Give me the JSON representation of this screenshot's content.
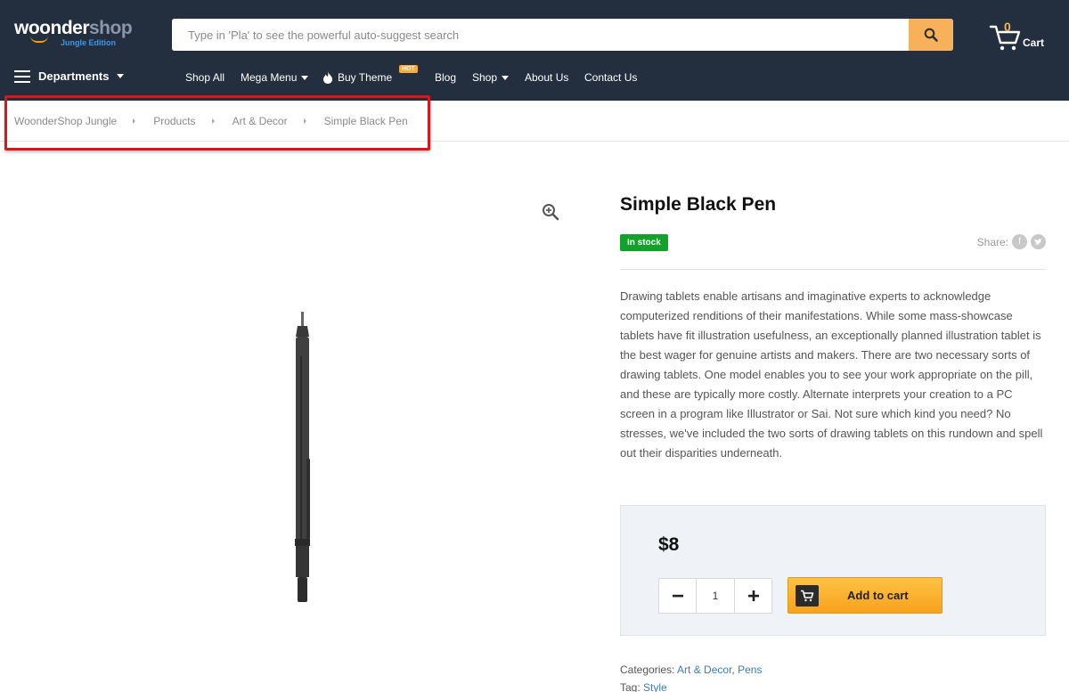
{
  "brand": {
    "name_part1": "woonder",
    "name_part2": "shop",
    "edition": "Jungle Edition"
  },
  "search": {
    "placeholder": "Type in 'Pla' to see the powerful auto-suggest search"
  },
  "cart": {
    "count": "0",
    "label": "Cart"
  },
  "nav": {
    "departments": "Departments",
    "items": {
      "shop_all": "Shop All",
      "mega_menu": "Mega Menu",
      "buy_theme": "Buy Theme",
      "hot_badge": "HOT",
      "blog": "Blog",
      "shop": "Shop",
      "about": "About Us",
      "contact": "Contact Us"
    }
  },
  "breadcrumb": [
    "WoonderShop Jungle",
    "Products",
    "Art & Decor",
    "Simple Black Pen"
  ],
  "product": {
    "title": "Simple Black Pen",
    "stock": "In stock",
    "share_label": "Share:",
    "description": "Drawing tablets enable artisans and imaginative experts to acknowledge computerized renditions of their manifestations. While some mass-showcase tablets have fit illustration usefulness, an exceptionally planned illustration tablet is the best wager for genuine artists and makers. There are two necessary sorts of drawing tablets. One model enables you to see your work appropriate on the pill, and these are typically more costly. Alternate interprets your creation to a PC screen in a program like Illustrator or Sai. Not sure which kind you need? No stresses, we've included the two sorts of drawing tablets on this rundown and spell out their disparities underneath.",
    "price": "$8",
    "quantity": "1",
    "add_to_cart": "Add to cart",
    "categories_label": "Categories:",
    "categories": [
      "Art & Decor",
      "Pens"
    ],
    "category_sep": ",",
    "tag_label": "Tag:",
    "tag": "Style"
  },
  "colors": {
    "header_bg": "#232f3e",
    "accent": "#f7b15a",
    "in_stock": "#12a12a",
    "link": "#3b7bbf",
    "highlight": "#d9161c"
  }
}
